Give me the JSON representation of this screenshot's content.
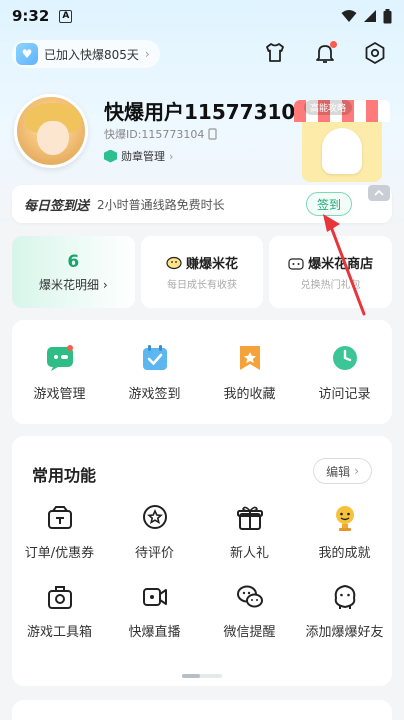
{
  "status_bar": {
    "time": "9:32",
    "notif_letter": "A"
  },
  "header": {
    "joined_text": "已加入快爆805天",
    "icons": [
      "shirt-icon",
      "bell-icon",
      "settings-icon"
    ]
  },
  "profile": {
    "username": "快爆用户115773104",
    "user_id": "快爆ID:115773104",
    "badge_management": "勋章管理",
    "banner_tag": "高能攻略"
  },
  "signin": {
    "title": "每日签到送",
    "description": "2小时普通线路免费时长",
    "button": "签到"
  },
  "stats": [
    {
      "value": "6",
      "label": "爆米花明细"
    },
    {
      "title": "赚爆米花",
      "subtitle": "每日成长有收获"
    },
    {
      "title": "爆米花商店",
      "subtitle": "兑换热门礼包"
    }
  ],
  "quick_actions": [
    {
      "label": "游戏管理",
      "icon": "game-manage-icon"
    },
    {
      "label": "游戏签到",
      "icon": "game-signin-icon"
    },
    {
      "label": "我的收藏",
      "icon": "favorites-icon"
    },
    {
      "label": "访问记录",
      "icon": "history-icon"
    }
  ],
  "common_functions": {
    "title": "常用功能",
    "edit_label": "编辑",
    "items": [
      {
        "label": "订单/优惠券",
        "icon": "wallet-icon"
      },
      {
        "label": "待评价",
        "icon": "review-icon"
      },
      {
        "label": "新人礼",
        "icon": "gift-icon"
      },
      {
        "label": "我的成就",
        "icon": "trophy-icon"
      },
      {
        "label": "游戏工具箱",
        "icon": "toolbox-icon"
      },
      {
        "label": "快爆直播",
        "icon": "live-icon"
      },
      {
        "label": "微信提醒",
        "icon": "wechat-icon"
      },
      {
        "label": "添加爆爆好友",
        "icon": "friend-icon"
      }
    ]
  },
  "colors": {
    "accent_green": "#17a46e",
    "arrow_red": "#e8343b",
    "background": "#f3f5f7"
  }
}
